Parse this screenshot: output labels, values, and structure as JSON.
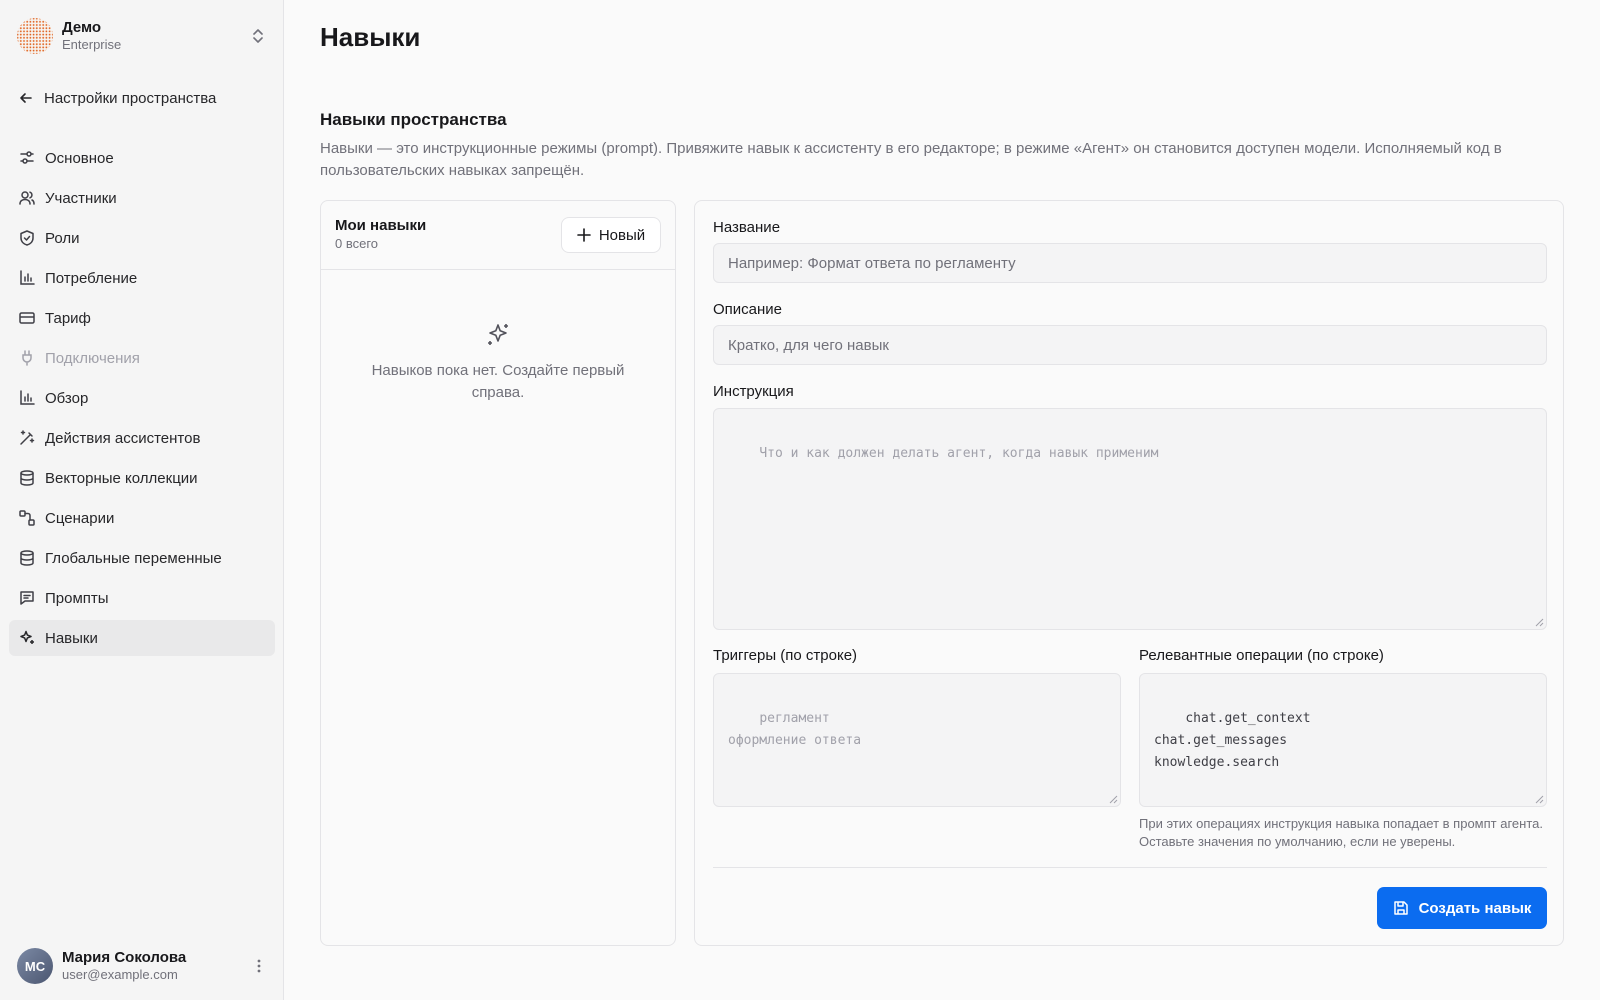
{
  "workspace": {
    "name": "Демо",
    "plan": "Enterprise"
  },
  "sidebar": {
    "back_label": "Настройки пространства",
    "items": [
      {
        "label": "Основное",
        "icon": "sliders-icon"
      },
      {
        "label": "Участники",
        "icon": "users-icon"
      },
      {
        "label": "Роли",
        "icon": "shield-icon"
      },
      {
        "label": "Потребление",
        "icon": "bar-chart-icon"
      },
      {
        "label": "Тариф",
        "icon": "credit-card-icon"
      },
      {
        "label": "Подключения",
        "icon": "plug-icon",
        "disabled": true
      },
      {
        "label": "Обзор",
        "icon": "bar-chart-icon"
      },
      {
        "label": "Действия ассистентов",
        "icon": "magic-wand-icon"
      },
      {
        "label": "Векторные коллекции",
        "icon": "database-icon"
      },
      {
        "label": "Сценарии",
        "icon": "workflow-icon"
      },
      {
        "label": "Глобальные переменные",
        "icon": "database-icon"
      },
      {
        "label": "Промпты",
        "icon": "message-square-icon"
      },
      {
        "label": "Навыки",
        "icon": "sparkles-icon",
        "active": true
      }
    ]
  },
  "user": {
    "initials": "МС",
    "name": "Мария Соколова",
    "email": "user@example.com"
  },
  "page": {
    "title": "Навыки",
    "section_title": "Навыки пространства",
    "section_desc": "Навыки — это инструкционные режимы (prompt). Привяжите навык к ассистенту в его редакторе; в режиме «Агент» он становится доступен модели. Исполняемый код в пользовательских навыках запрещён."
  },
  "skills_list": {
    "title": "Мои навыки",
    "count": "0 всего",
    "new_button": "Новый",
    "empty_text": "Навыков пока нет. Создайте первый справа."
  },
  "form": {
    "name_label": "Название",
    "name_placeholder": "Например: Формат ответа по регламенту",
    "desc_label": "Описание",
    "desc_placeholder": "Кратко, для чего навык",
    "instruction_label": "Инструкция",
    "instruction_placeholder": "Что и как должен делать агент, когда навык применим",
    "triggers_label": "Триггеры (по строке)",
    "triggers_placeholder": "регламент\nоформление ответа",
    "ops_label": "Релевантные операции (по строке)",
    "ops_value": "chat.get_context\nchat.get_messages\nknowledge.search",
    "ops_hint": "При этих операциях инструкция навыка попадает в промпт агента. Оставьте значения по умолчанию, если не уверены.",
    "create_button": "Создать навык"
  },
  "colors": {
    "accent": "#0b6cf0",
    "sidebar_bg": "#f5f5f5",
    "active_bg": "#e9e9ea"
  }
}
